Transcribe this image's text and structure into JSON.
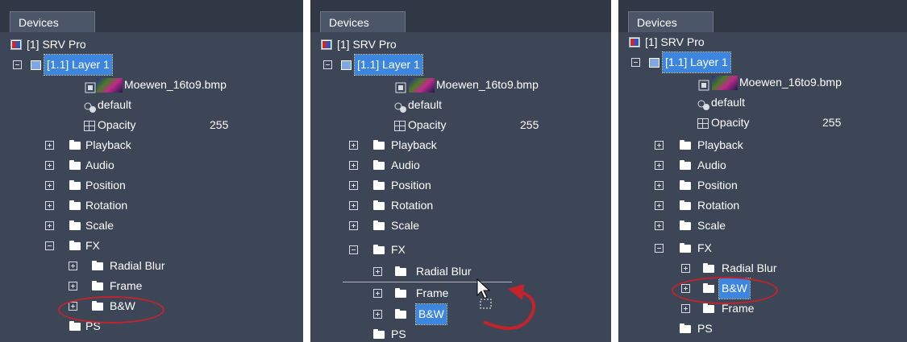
{
  "panel_title": "Devices",
  "server": "[1] SRV Pro",
  "layer": "[1.1] Layer 1",
  "media": "Moewen_16to9.bmp",
  "default_label": "default",
  "opacity_label": "Opacity",
  "opacity_value": "255",
  "groups": {
    "playback": "Playback",
    "audio": "Audio",
    "position": "Position",
    "rotation": "Rotation",
    "scale": "Scale",
    "fx": "FX",
    "ps": "PS"
  },
  "fx_items": {
    "radial_blur": "Radial Blur",
    "frame": "Frame",
    "bw": "B&W"
  },
  "accent": "#3d86e0",
  "highlight_color": "#c4232b"
}
